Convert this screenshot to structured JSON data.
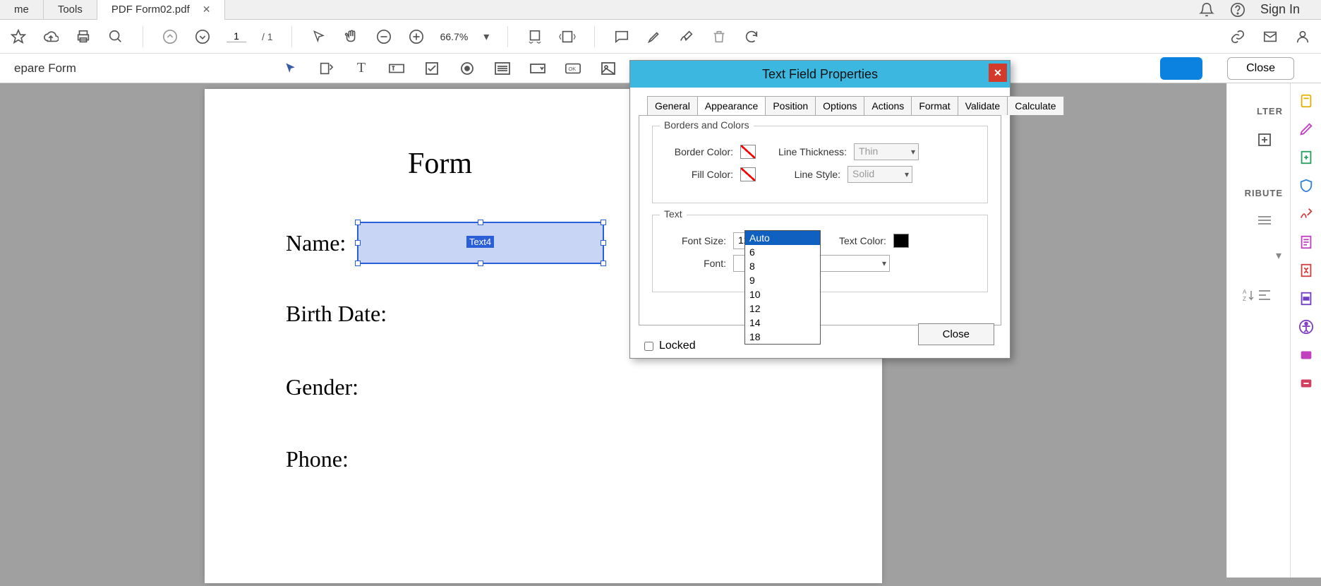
{
  "tabbar": {
    "tab_me": "me",
    "tab_tools": "Tools",
    "tab_file": "PDF Form02.pdf",
    "signin": "Sign In"
  },
  "maintoolbar": {
    "page_current": "1",
    "page_total": "1",
    "zoom": "66.7%"
  },
  "formbar": {
    "prepare": "epare Form",
    "close": "Close"
  },
  "rightpanel": {
    "hdr1": "LTER",
    "hdr2": "RIBUTE"
  },
  "document": {
    "title": "Form",
    "labels": {
      "name": "Name:",
      "birth": "Birth Date:",
      "gender": "Gender:",
      "phone": "Phone:"
    },
    "field_tag": "Text4"
  },
  "dialog": {
    "title": "Text Field Properties",
    "tabs": {
      "general": "General",
      "appearance": "Appearance",
      "position": "Position",
      "options": "Options",
      "actions": "Actions",
      "format": "Format",
      "validate": "Validate",
      "calculate": "Calculate"
    },
    "group_borders": "Borders and Colors",
    "group_text": "Text",
    "border_color": "Border Color:",
    "fill_color": "Fill Color:",
    "line_thickness": "Line Thickness:",
    "line_style": "Line Style:",
    "thin": "Thin",
    "solid": "Solid",
    "font_size": "Font Size:",
    "font_size_value": "12",
    "text_color": "Text Color:",
    "font": "Font:",
    "locked": "Locked",
    "close": "Close",
    "size_options": {
      "auto": "Auto",
      "s6": "6",
      "s8": "8",
      "s9": "9",
      "s10": "10",
      "s12": "12",
      "s14": "14",
      "s18": "18"
    }
  }
}
